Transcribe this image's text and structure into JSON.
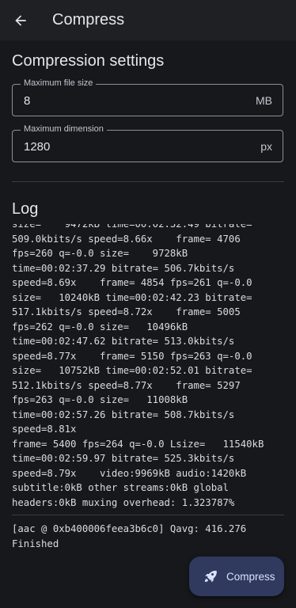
{
  "appbar": {
    "title": "Compress",
    "back_icon": "arrow-back-icon"
  },
  "settings": {
    "title": "Compression settings",
    "max_file_size": {
      "label": "Maximum file size",
      "value": "8",
      "unit": "MB"
    },
    "max_dimension": {
      "label": "Maximum dimension",
      "value": "1280",
      "unit": "px"
    }
  },
  "log": {
    "title": "Log",
    "lines": [
      "size=    9472kB time=00:02:32.49 bitrate=",
      "509.0kbits/s speed=8.66x    frame= 4706",
      "fps=260 q=-0.0 size=    9728kB",
      "time=00:02:37.29 bitrate= 506.7kbits/s",
      "speed=8.69x    frame= 4854 fps=261 q=-0.0",
      "size=   10240kB time=00:02:42.23 bitrate=",
      "517.1kbits/s speed=8.72x    frame= 5005",
      "fps=262 q=-0.0 size=   10496kB",
      "time=00:02:47.62 bitrate= 513.0kbits/s",
      "speed=8.77x    frame= 5150 fps=263 q=-0.0",
      "size=   10752kB time=00:02:52.01 bitrate=",
      "512.1kbits/s speed=8.77x    frame= 5297",
      "fps=263 q=-0.0 size=   11008kB",
      "time=00:02:57.26 bitrate= 508.7kbits/s",
      "speed=8.81x",
      "frame= 5400 fps=264 q=-0.0 Lsize=   11540kB",
      "time=00:02:59.97 bitrate= 525.3kbits/s",
      "speed=8.79x    video:9969kB audio:1420kB",
      "subtitle:0kB other streams:0kB global",
      "headers:0kB muxing overhead: 1.323787%"
    ],
    "tail_lines": [
      "[aac @ 0xb400006feea3b6c0] Qavg: 416.276",
      "Finished"
    ]
  },
  "fab": {
    "label": "Compress",
    "icon": "rocket-icon"
  },
  "colors": {
    "background": "#17181c",
    "appbar": "#1f2024",
    "fab": "#2f3a5e",
    "fab_text": "#dbe1ff"
  }
}
